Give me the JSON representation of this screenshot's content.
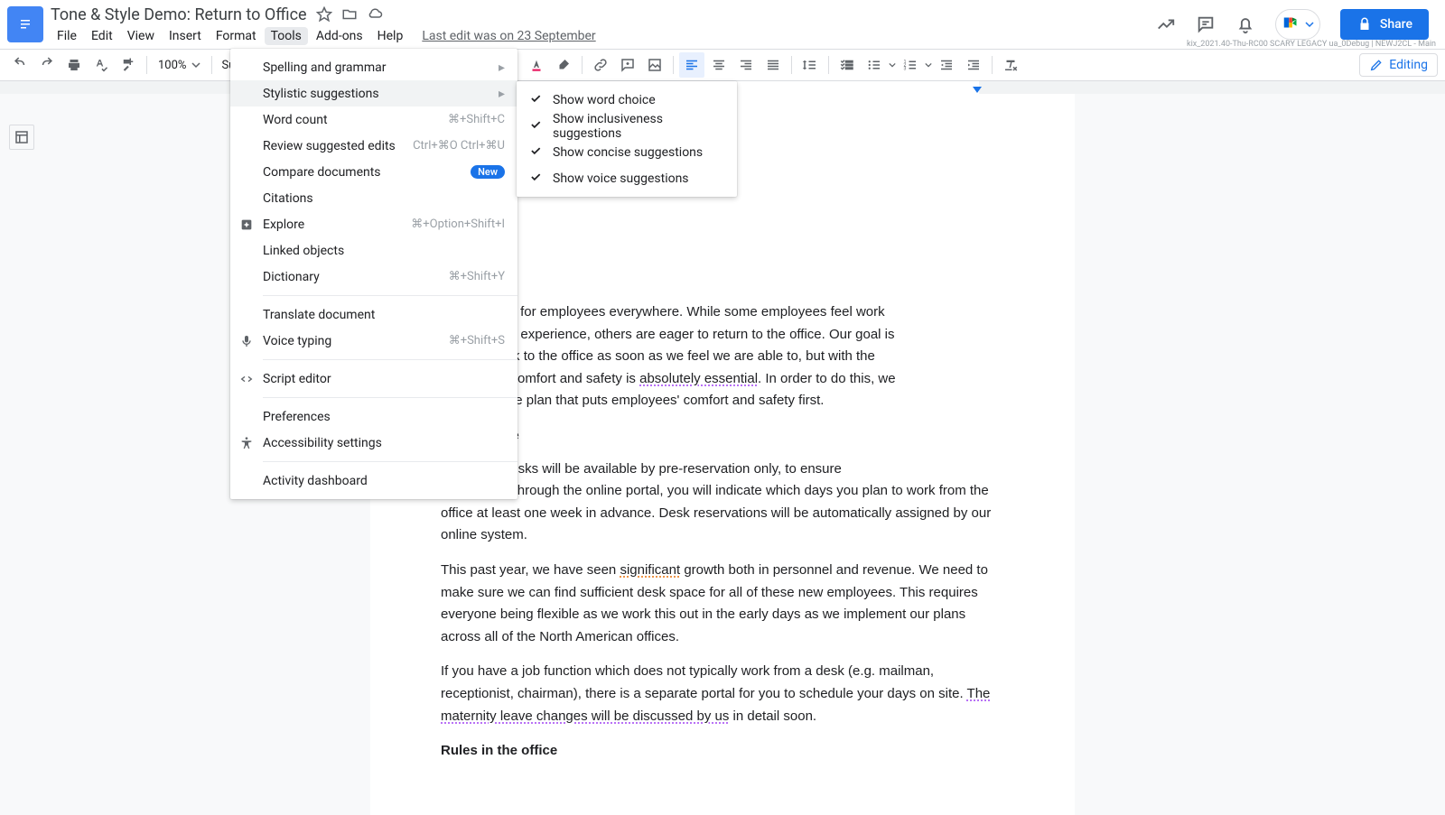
{
  "header": {
    "doc_title": "Tone & Style Demo: Return to Office",
    "menubar": [
      "File",
      "Edit",
      "View",
      "Insert",
      "Format",
      "Tools",
      "Add-ons",
      "Help"
    ],
    "active_menu_index": 5,
    "last_edit": "Last edit was on 23 September",
    "share_label": "Share",
    "debug_line": "kix_2021.40-Thu-RC00 SCARY LEGACY ua_0Debug | NEWJ2CL - Main"
  },
  "toolbar": {
    "zoom": "100%",
    "paragraph_style": "Subtitl",
    "mode_label": "Editing"
  },
  "tools_menu": {
    "items": [
      {
        "label": "Spelling and grammar",
        "submenu": true
      },
      {
        "label": "Stylistic suggestions",
        "submenu": true,
        "hover": true
      },
      {
        "label": "Word count",
        "shortcut": "⌘+Shift+C"
      },
      {
        "label": "Review suggested edits",
        "shortcut": "Ctrl+⌘O Ctrl+⌘U"
      },
      {
        "label": "Compare documents",
        "badge": "New"
      },
      {
        "label": "Citations"
      },
      {
        "label": "Explore",
        "icon": "explore",
        "shortcut": "⌘+Option+Shift+I"
      },
      {
        "label": "Linked objects"
      },
      {
        "label": "Dictionary",
        "shortcut": "⌘+Shift+Y"
      },
      {
        "sep": true
      },
      {
        "label": "Translate document"
      },
      {
        "label": "Voice typing",
        "icon": "mic",
        "shortcut": "⌘+Shift+S"
      },
      {
        "sep": true
      },
      {
        "label": "Script editor",
        "icon": "code"
      },
      {
        "sep": true
      },
      {
        "label": "Preferences"
      },
      {
        "label": "Accessibility settings",
        "icon": "a11y"
      },
      {
        "sep": true
      },
      {
        "label": "Activity dashboard"
      }
    ]
  },
  "stylistic_submenu": {
    "items": [
      {
        "label": "Show word choice",
        "checked": true
      },
      {
        "label": "Show inclusiveness suggestions",
        "checked": true
      },
      {
        "label": "Show concise suggestions",
        "checked": true
      },
      {
        "label": "Show voice suggestions",
        "checked": true
      }
    ]
  },
  "document": {
    "p1_a": "been difficult for employees everywhere. While some employees feel work ",
    "p1_b": "en a positive experience, others are eager to return to the office. Our goal is ",
    "p1_c": "ployees back to the office as soon as we feel we are able to, but with the ",
    "p1_d_pre": "t employee comfort and safety is ",
    "p1_d_sug": "absolutely essential",
    "p1_d_post": ". In order to do this, we ",
    "p1_e": "eturn to office plan that puts employees' comfort and safety first.",
    "h1": " in the Office",
    "p2_a": " the office, desks will be available by pre-reservation only, to ensure ",
    "p2_b": " distancing. Through the online portal, you will indicate which days you plan to work from the office at least one week in advance.  Desk reservations will be automatically assigned by our online system.",
    "p3_a": "This past year, we have seen ",
    "p3_sug": "significant",
    "p3_b": " growth both in personnel and revenue. We need to make sure we can find sufficient desk space for all of these new employees. This requires everyone being flexible as we work this out in the early days as we implement our plans across all of the North American offices.",
    "p4_a": "If you have a job function which does not typically work from a desk (e.g. mailman, receptionist, chairman), there is a separate portal for you to schedule your days on site. ",
    "p4_sug": "The maternity leave changes will be discussed by us",
    "p4_b": " in detail soon.",
    "h2": "Rules in the office"
  }
}
